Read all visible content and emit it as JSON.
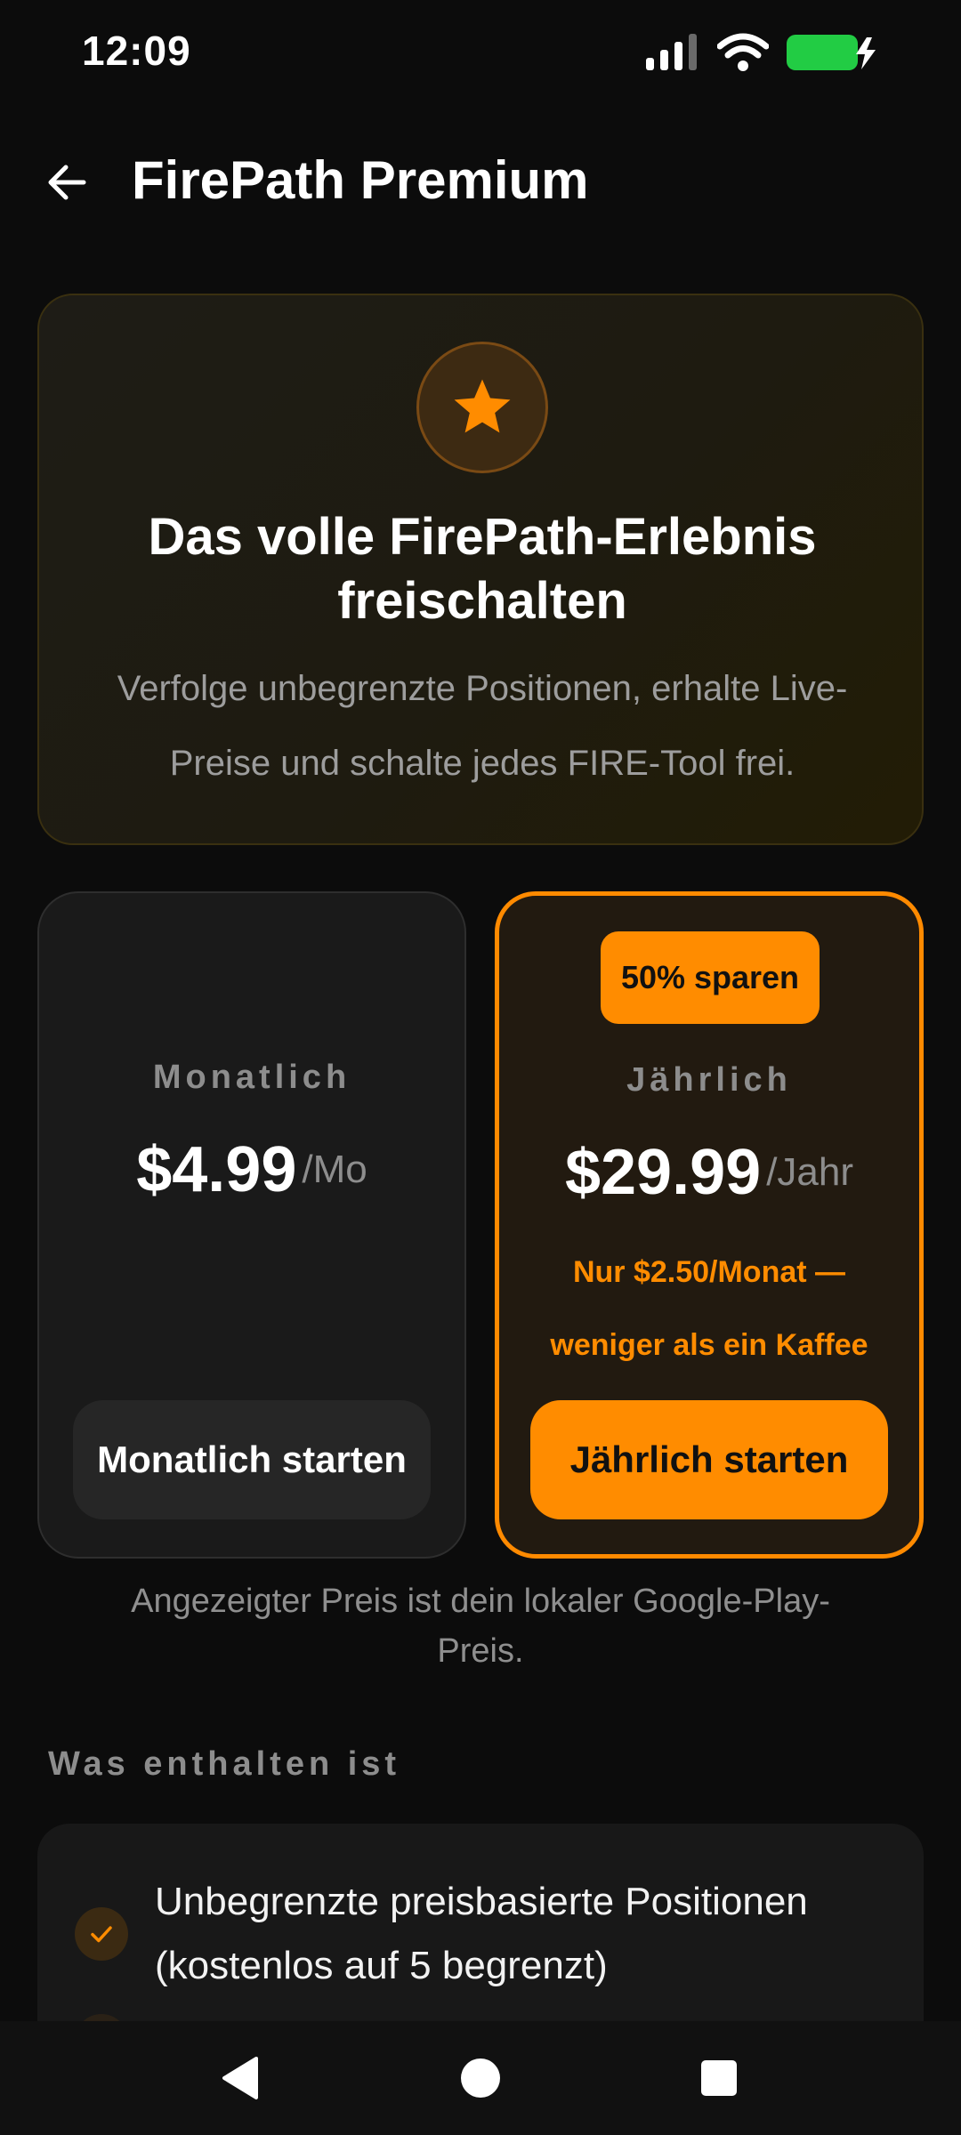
{
  "status_bar": {
    "time": "12:09",
    "battery_color": "#22cc44"
  },
  "app_bar": {
    "title": "FirePath Premium"
  },
  "hero": {
    "icon": "star-icon",
    "title": "Das volle FirePath-Erlebnis freischalten",
    "description": "Verfolge unbegrenzte Positionen, erhalte Live-Preise und schalte jedes FIRE-Tool frei."
  },
  "plans": {
    "monthly": {
      "name": "Monatlich",
      "price": "$4.99",
      "unit": "/Mo",
      "button": "Monatlich starten"
    },
    "yearly": {
      "badge": "50% sparen",
      "name": "Jährlich",
      "price": "$29.99",
      "unit": "/Jahr",
      "note": "Nur $2.50/Monat — weniger als ein Kaffee",
      "button": "Jährlich starten"
    }
  },
  "price_note": "Angezeigter Preis ist dein lokaler Google-Play-Preis.",
  "features_section": {
    "title": "Was enthalten ist",
    "items": [
      {
        "text": "Unbegrenzte preisbasierte Positionen (kostenlos auf 5 begrenzt)"
      }
    ]
  },
  "accent_color": "#ff8c00"
}
